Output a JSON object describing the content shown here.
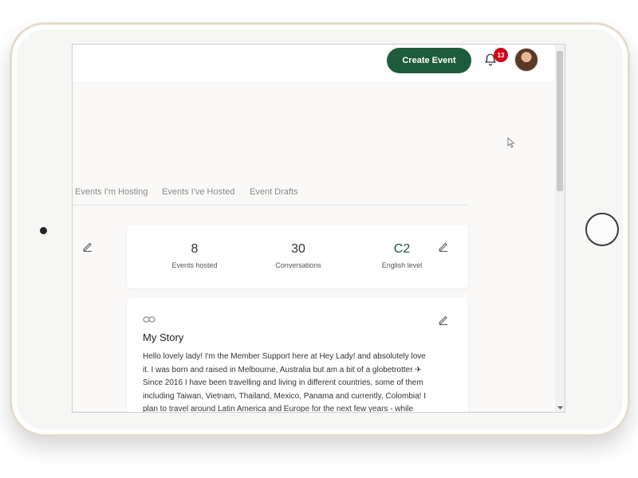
{
  "header": {
    "create_event_label": "Create Event",
    "notification_count": "13"
  },
  "tabs": [
    {
      "label": "Events I'm Hosting"
    },
    {
      "label": "Events I've Hosted"
    },
    {
      "label": "Event Drafts"
    }
  ],
  "stats": [
    {
      "value": "8",
      "label": "Events hosted"
    },
    {
      "value": "30",
      "label": "Conversations"
    },
    {
      "value": "C2",
      "label": "English level"
    }
  ],
  "story": {
    "title": "My Story",
    "text": "Hello lovely lady! I'm the Member Support here at Hey Lady! and absolutely love it. I was born and raised in Melbourne, Australia but am a bit of a globetrotter ✈ Since 2016 I have been travelling and living in different countries, some of them including Taiwan, Vietnam, Thailand, Mexico, Panama and currently, Colombia! I plan to travel around Latin America and Europe for the next few years - while working on my Spanish! I hope I can meet you in person one day on one of my adventures! If you ever have any issues or questions about using the platform, your membership or payments, please send me a message."
  },
  "colors": {
    "brand_green": "#1e5a3c",
    "badge_red": "#d0021b"
  },
  "icons": [
    "bell-icon",
    "pencil-icon",
    "link-icon",
    "cursor-icon",
    "chevron-down-icon"
  ]
}
